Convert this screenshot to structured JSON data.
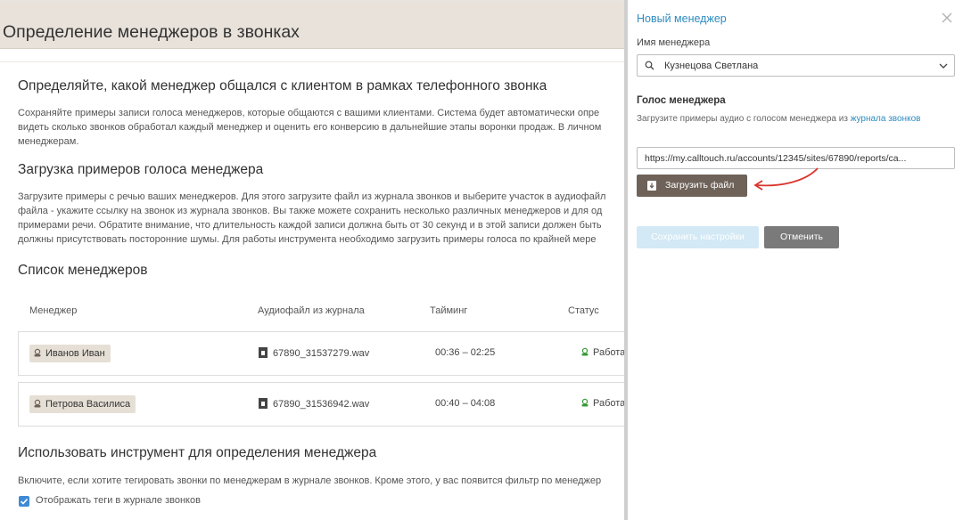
{
  "header": {
    "title": "Определение менеджеров в звонках"
  },
  "intro": {
    "title": "Определяйте, какой менеджер общался с клиентом в рамках телефонного звонка",
    "lines": [
      "Сохраняйте примеры записи голоса менеджеров, которые общаются с вашими клиентами. Система будет автоматически опре",
      "видеть сколько звонков обработал каждый менеджер и оценить его конверсию в дальнейшие этапы воронки продаж. В личном",
      "менеджерам."
    ]
  },
  "upload_section": {
    "title": "Загрузка примеров голоса менеджера",
    "lines": [
      "Загрузите примеры с речью ваших менеджеров. Для этого загрузите файл из журнала звонков и выберите участок в аудиофайл",
      "файла - укажите ссылку на звонок из журнала звонков. Вы также можете сохранить несколько различных менеджеров и для од",
      "примерами речи. Обратите внимание, что длительность каждой записи должна быть от 30 секунд и в этой записи должен быть",
      "должны присутствовать посторонние шумы. Для работы инструмента необходимо загрузить примеры голоса по крайней мере"
    ]
  },
  "managers": {
    "title": "Список менеджеров",
    "columns": [
      "Менеджер",
      "Аудиофайл из журнала",
      "Тайминг",
      "Статус"
    ],
    "rows": [
      {
        "name": "Иванов Иван",
        "file": "67890_31537279.wav",
        "timing": "00:36 – 02:25",
        "status": "Работа"
      },
      {
        "name": "Петрова Василиса",
        "file": "67890_31536942.wav",
        "timing": "00:40 – 04:08",
        "status": "Работа"
      }
    ]
  },
  "tool": {
    "title": "Использовать инструмент для определения менеджера",
    "desc": "Включите, если хотите тегировать звонки по менеджерам в журнале звонков. Кроме этого, у вас появится фильтр по менеджер",
    "checkbox_label": "Отображать теги в журнале звонков",
    "checked": true
  },
  "panel": {
    "title": "Новый менеджер",
    "name_label": "Имя менеджера",
    "name_value": "Кузнецова Светлана",
    "voice_title": "Голос менеджера",
    "voice_desc": "Загрузите примеры аудио с голосом менеджера из ",
    "voice_link": "журнала звонков",
    "url_value": "https://my.calltouch.ru/accounts/12345/sites/67890/reports/ca...",
    "upload_label": "Загрузить файл",
    "save_label": "Сохранить настройки",
    "cancel_label": "Отменить"
  },
  "colors": {
    "accent": "#2f8cc0",
    "header_bg": "#e8e2db",
    "tag_bg": "#e6dfd6",
    "upload_bg": "#6e6259",
    "annotation_arrow": "#d9342b",
    "status_icon": "#3a9b3a"
  }
}
